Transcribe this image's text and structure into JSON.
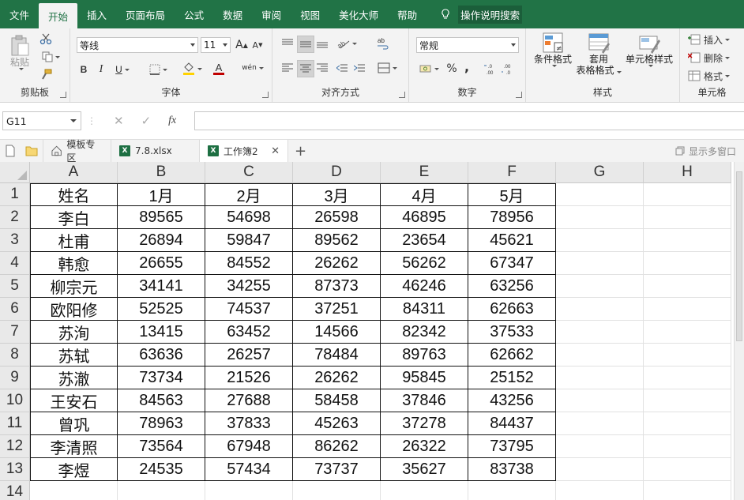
{
  "colors": {
    "accent": "#217346",
    "ribbon_bg": "#f3f3f3"
  },
  "menu": {
    "tabs": [
      "文件",
      "开始",
      "插入",
      "页面布局",
      "公式",
      "数据",
      "审阅",
      "视图",
      "美化大师",
      "帮助"
    ],
    "tell_me": "操作说明搜索"
  },
  "ribbon": {
    "clipboard": {
      "label": "剪贴板",
      "paste": "粘贴"
    },
    "font": {
      "label": "字体",
      "font_name": "等线",
      "font_size": "11",
      "bold": "B",
      "italic": "I",
      "underline": "U",
      "grow": "A",
      "shrink": "A",
      "wen": "wén"
    },
    "alignment": {
      "label": "对齐方式"
    },
    "number": {
      "label": "数字",
      "format": "常规",
      "percent": "%",
      "comma": ","
    },
    "styles": {
      "label": "样式",
      "conditional": "条件格式",
      "table_line1": "套用",
      "table_line2": "表格格式",
      "cell_styles": "单元格样式"
    },
    "cells": {
      "label": "单元格",
      "insert": "插入",
      "delete": "删除",
      "format": "格式"
    }
  },
  "formula_bar": {
    "name_box": "G11",
    "fx": "fx",
    "value": ""
  },
  "file_tabs": {
    "templates": "模板专区",
    "file1": "7.8.xlsx",
    "file2": "工作簿2",
    "add": "+",
    "show_multi": "显示多窗口"
  },
  "sheet": {
    "columns": [
      "A",
      "B",
      "C",
      "D",
      "E",
      "F",
      "G",
      "H"
    ],
    "rows": [
      "1",
      "2",
      "3",
      "4",
      "5",
      "6",
      "7",
      "8",
      "9",
      "10",
      "11",
      "12",
      "13",
      "14"
    ],
    "table": [
      [
        "姓名",
        "1月",
        "2月",
        "3月",
        "4月",
        "5月"
      ],
      [
        "李白",
        "89565",
        "54698",
        "26598",
        "46895",
        "78956"
      ],
      [
        "杜甫",
        "26894",
        "59847",
        "89562",
        "23654",
        "45621"
      ],
      [
        "韩愈",
        "26655",
        "84552",
        "26262",
        "56262",
        "67347"
      ],
      [
        "柳宗元",
        "34141",
        "34255",
        "87373",
        "46246",
        "63256"
      ],
      [
        "欧阳修",
        "52525",
        "74537",
        "37251",
        "84311",
        "62663"
      ],
      [
        "苏洵",
        "13415",
        "63452",
        "14566",
        "82342",
        "37533"
      ],
      [
        "苏轼",
        "63636",
        "26257",
        "78484",
        "89763",
        "62662"
      ],
      [
        "苏澈",
        "73734",
        "21526",
        "26262",
        "95845",
        "25152"
      ],
      [
        "王安石",
        "84563",
        "27688",
        "58458",
        "37846",
        "43256"
      ],
      [
        "曾巩",
        "78963",
        "37833",
        "45263",
        "37278",
        "84437"
      ],
      [
        "李清照",
        "73564",
        "67948",
        "86262",
        "26322",
        "73795"
      ],
      [
        "李煜",
        "24535",
        "57434",
        "73737",
        "35627",
        "83738"
      ]
    ]
  }
}
